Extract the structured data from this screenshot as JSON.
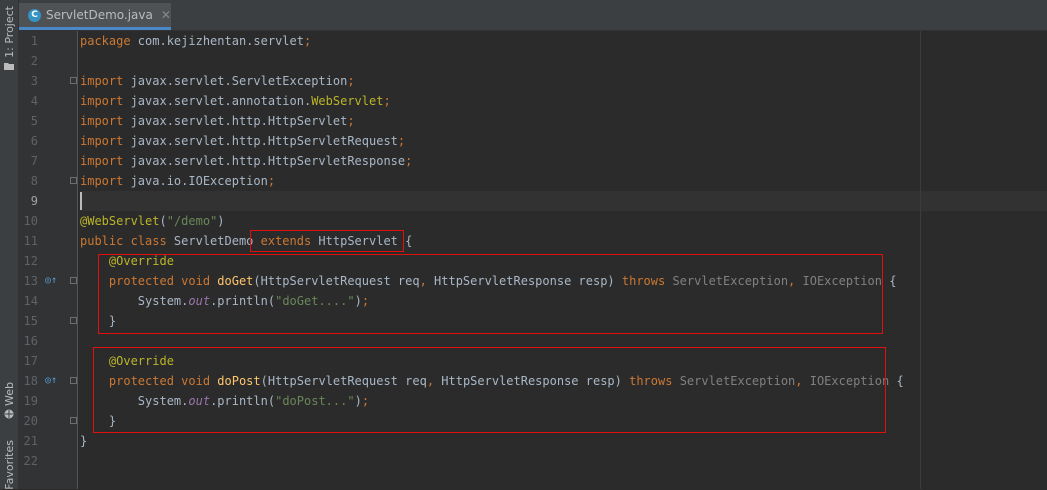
{
  "sidebar": {
    "project_label": "1: Project",
    "web_label": "Web",
    "favorites_label": "Favorites"
  },
  "tab": {
    "icon_letter": "C",
    "filename": "ServletDemo.java",
    "close": "✕"
  },
  "lines": [
    {
      "n": "1",
      "tokens": [
        {
          "t": "package ",
          "c": "kw"
        },
        {
          "t": "com.kejizhentan.servlet",
          "c": ""
        },
        {
          "t": ";",
          "c": "kw"
        }
      ]
    },
    {
      "n": "2",
      "tokens": []
    },
    {
      "n": "3",
      "tokens": [
        {
          "t": "import ",
          "c": "kw"
        },
        {
          "t": "javax.servlet.ServletException",
          "c": ""
        },
        {
          "t": ";",
          "c": "kw"
        }
      ]
    },
    {
      "n": "4",
      "tokens": [
        {
          "t": "import ",
          "c": "kw"
        },
        {
          "t": "javax.servlet.annotation.",
          "c": ""
        },
        {
          "t": "WebServlet",
          "c": "an"
        },
        {
          "t": ";",
          "c": "kw"
        }
      ]
    },
    {
      "n": "5",
      "tokens": [
        {
          "t": "import ",
          "c": "kw"
        },
        {
          "t": "javax.servlet.http.HttpServlet",
          "c": ""
        },
        {
          "t": ";",
          "c": "kw"
        }
      ]
    },
    {
      "n": "6",
      "tokens": [
        {
          "t": "import ",
          "c": "kw"
        },
        {
          "t": "javax.servlet.http.HttpServletRequest",
          "c": ""
        },
        {
          "t": ";",
          "c": "kw"
        }
      ]
    },
    {
      "n": "7",
      "tokens": [
        {
          "t": "import ",
          "c": "kw"
        },
        {
          "t": "javax.servlet.http.HttpServletResponse",
          "c": ""
        },
        {
          "t": ";",
          "c": "kw"
        }
      ]
    },
    {
      "n": "8",
      "tokens": [
        {
          "t": "import ",
          "c": "kw"
        },
        {
          "t": "java.io.IOException",
          "c": ""
        },
        {
          "t": ";",
          "c": "kw"
        }
      ]
    },
    {
      "n": "9",
      "tokens": []
    },
    {
      "n": "10",
      "tokens": [
        {
          "t": "@WebServlet",
          "c": "an"
        },
        {
          "t": "(",
          "c": ""
        },
        {
          "t": "\"/demo\"",
          "c": "st"
        },
        {
          "t": ")",
          "c": ""
        }
      ]
    },
    {
      "n": "11",
      "tokens": [
        {
          "t": "public class ",
          "c": "kw"
        },
        {
          "t": "ServletDemo ",
          "c": ""
        },
        {
          "t": "extends ",
          "c": "kw"
        },
        {
          "t": "HttpServlet {",
          "c": ""
        }
      ]
    },
    {
      "n": "12",
      "tokens": [
        {
          "t": "    ",
          "c": ""
        },
        {
          "t": "@Override",
          "c": "an"
        }
      ]
    },
    {
      "n": "13",
      "tokens": [
        {
          "t": "    ",
          "c": ""
        },
        {
          "t": "protected void ",
          "c": "kw"
        },
        {
          "t": "doGet",
          "c": "fn"
        },
        {
          "t": "(HttpServletRequest req",
          "c": ""
        },
        {
          "t": ", ",
          "c": "kw"
        },
        {
          "t": "HttpServletResponse resp) ",
          "c": ""
        },
        {
          "t": "throws ",
          "c": "kw"
        },
        {
          "t": "ServletException",
          "c": "dim"
        },
        {
          "t": ", ",
          "c": "kw"
        },
        {
          "t": "IOException ",
          "c": "dim"
        },
        {
          "t": "{",
          "c": ""
        }
      ]
    },
    {
      "n": "14",
      "tokens": [
        {
          "t": "        System.",
          "c": ""
        },
        {
          "t": "out",
          "c": "sf"
        },
        {
          "t": ".println(",
          "c": ""
        },
        {
          "t": "\"doGet....\"",
          "c": "st"
        },
        {
          "t": ")",
          "c": ""
        },
        {
          "t": ";",
          "c": "kw"
        }
      ]
    },
    {
      "n": "15",
      "tokens": [
        {
          "t": "    }",
          "c": ""
        }
      ]
    },
    {
      "n": "16",
      "tokens": []
    },
    {
      "n": "17",
      "tokens": [
        {
          "t": "    ",
          "c": ""
        },
        {
          "t": "@Override",
          "c": "an"
        }
      ]
    },
    {
      "n": "18",
      "tokens": [
        {
          "t": "    ",
          "c": ""
        },
        {
          "t": "protected void ",
          "c": "kw"
        },
        {
          "t": "doPost",
          "c": "fn"
        },
        {
          "t": "(HttpServletRequest req",
          "c": ""
        },
        {
          "t": ", ",
          "c": "kw"
        },
        {
          "t": "HttpServletResponse resp) ",
          "c": ""
        },
        {
          "t": "throws ",
          "c": "kw"
        },
        {
          "t": "ServletException",
          "c": "dim"
        },
        {
          "t": ", ",
          "c": "kw"
        },
        {
          "t": "IOException ",
          "c": "dim"
        },
        {
          "t": "{",
          "c": ""
        }
      ]
    },
    {
      "n": "19",
      "tokens": [
        {
          "t": "        System.",
          "c": ""
        },
        {
          "t": "out",
          "c": "sf"
        },
        {
          "t": ".println(",
          "c": ""
        },
        {
          "t": "\"doPost...\"",
          "c": "st"
        },
        {
          "t": ")",
          "c": ""
        },
        {
          "t": ";",
          "c": "kw"
        }
      ]
    },
    {
      "n": "20",
      "tokens": [
        {
          "t": "    }",
          "c": ""
        }
      ]
    },
    {
      "n": "21",
      "tokens": [
        {
          "t": "}",
          "c": ""
        }
      ]
    },
    {
      "n": "22",
      "tokens": []
    }
  ],
  "current_line": "9",
  "gutter_markers": [
    {
      "line": "13",
      "icon": "override-up-arrow-icon"
    },
    {
      "line": "18",
      "icon": "override-up-arrow-icon"
    }
  ],
  "colors": {
    "highlight_box": "#e0100d",
    "keyword": "#cc7832",
    "annotation": "#bbb529",
    "string": "#6a8759",
    "method": "#ffc66d",
    "static_field": "#9876aa"
  }
}
